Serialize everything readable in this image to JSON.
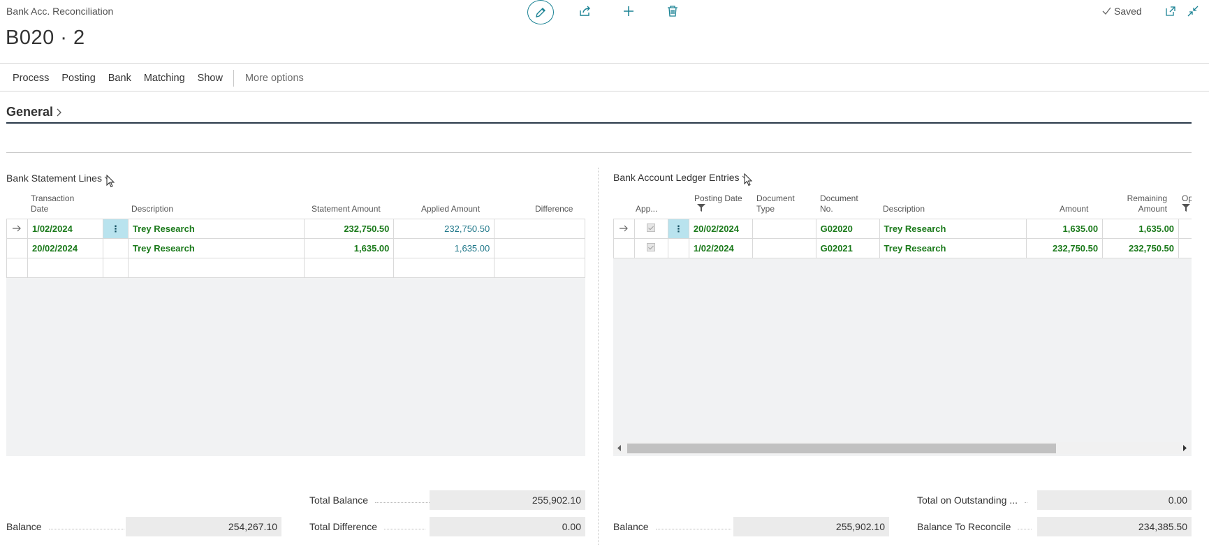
{
  "page": {
    "caption": "Bank Acc. Reconciliation",
    "title": "B020 · 2",
    "saved_label": "Saved"
  },
  "actions": {
    "items": [
      "Process",
      "Posting",
      "Bank",
      "Matching",
      "Show"
    ],
    "more": "More options"
  },
  "general": {
    "label": "General"
  },
  "statement": {
    "title": "Bank Statement Lines",
    "headers": {
      "transaction_date": "Transaction\nDate",
      "description": "Description",
      "statement_amount": "Statement Amount",
      "applied_amount": "Applied Amount",
      "difference": "Difference"
    },
    "rows": [
      {
        "date": "1/02/2024",
        "description": "Trey Research",
        "statement_amount": "232,750.50",
        "applied_amount": "232,750.50",
        "difference": ""
      },
      {
        "date": "20/02/2024",
        "description": "Trey Research",
        "statement_amount": "1,635.00",
        "applied_amount": "1,635.00",
        "difference": ""
      }
    ]
  },
  "ledger": {
    "title": "Bank Account Ledger Entries",
    "headers": {
      "applied": "App...",
      "posting_date": "Posting Date",
      "document_type": "Document\nType",
      "document_no": "Document\nNo.",
      "description": "Description",
      "amount": "Amount",
      "remaining_amount": "Remaining\nAmount",
      "open": "Op"
    },
    "rows": [
      {
        "posting_date": "20/02/2024",
        "document_type": "",
        "document_no": "G02020",
        "description": "Trey Research",
        "amount": "1,635.00",
        "remaining_amount": "1,635.00"
      },
      {
        "posting_date": "1/02/2024",
        "document_type": "",
        "document_no": "G02021",
        "description": "Trey Research",
        "amount": "232,750.50",
        "remaining_amount": "232,750.50"
      }
    ]
  },
  "totals": {
    "left": {
      "balance_label": "Balance",
      "balance_value": "254,267.10",
      "total_balance_label": "Total Balance",
      "total_balance_value": "255,902.10",
      "total_difference_label": "Total Difference",
      "total_difference_value": "0.00"
    },
    "right": {
      "balance_label": "Balance",
      "balance_value": "255,902.10",
      "outstanding_label": "Total on Outstanding ...",
      "outstanding_value": "0.00",
      "to_reconcile_label": "Balance To Reconcile",
      "to_reconcile_value": "234,385.50"
    }
  },
  "colors": {
    "accent": "#1a8294",
    "positive_green": "#1b7a1b",
    "link_teal": "#21788a",
    "selected_cell": "#b9e3ee"
  }
}
